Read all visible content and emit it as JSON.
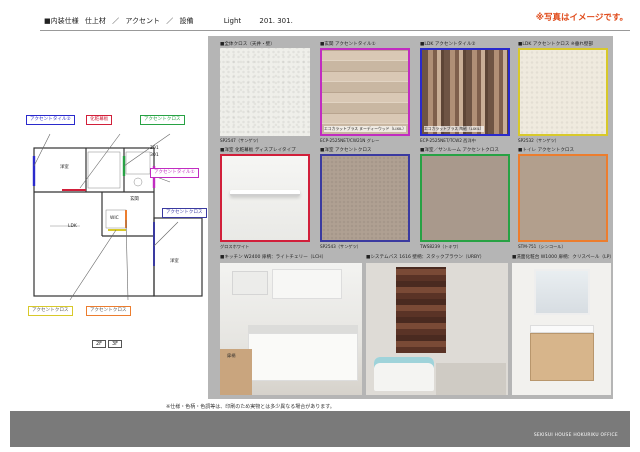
{
  "header": {
    "section": "■内装仕様",
    "breadcrumb": [
      "仕上材",
      "／",
      "アクセント",
      "／",
      "設備"
    ],
    "plan_type": "Light",
    "units": "201. 301.",
    "note": "※写真はイメージです。"
  },
  "plan": {
    "tags": [
      {
        "label": "アクセントタイル②",
        "color": "#2a2acc"
      },
      {
        "label": "化粧幕板",
        "color": "#d11f3a"
      },
      {
        "label": "アクセントクロス",
        "color": "#27a244"
      },
      {
        "label": "アクセントタイル①",
        "color": "#c12cc1"
      },
      {
        "label": "アクセントクロス",
        "color": "#3a3aa0"
      },
      {
        "label": "アクセントクロス",
        "color": "#d8c92a"
      },
      {
        "label": "アクセントクロス",
        "color": "#ec7d2e"
      }
    ],
    "room_labels": [
      "洋室",
      "LDK",
      "洋室",
      "WIC",
      "玄関"
    ],
    "unit_label_1": "201",
    "unit_label_2": "301",
    "floors": [
      "2F",
      "3F"
    ]
  },
  "finishes": [
    {
      "caption": "■全体クロス（天井・壁）",
      "code": "SP2547（サンゲツ）",
      "texture": "wall",
      "border": "transparent"
    },
    {
      "caption": "■玄関 アクセントタイル①",
      "code": "ECP-2525NET/CW21N グレー",
      "overlay": "エコカラットプラス ヌーディーウッド（LIXIL）",
      "texture": "tile1",
      "border": "#c12cc1"
    },
    {
      "caption": "■LDK アクセントタイル②",
      "code": "ECP-2525NET/TCW2 西洋中",
      "overlay": "エコカラットプラス 陶磁（LIXIL）",
      "texture": "tile2",
      "border": "#2a2acc"
    },
    {
      "caption": "■LDK アクセントクロス ※垂れ壁部",
      "code": "SP2532（サンゲツ）",
      "texture": "yellowish",
      "border": "#d8c92a"
    },
    {
      "caption": "■洋室 化粧幕板 ディスプレイタイプ",
      "code": "グロスホワイト",
      "texture": "white",
      "border": "#d11f3a"
    },
    {
      "caption": "■洋室 アクセントクロス",
      "code": "SP2543（サンゲツ）",
      "texture": "taupe",
      "border": "#3a3aa0"
    },
    {
      "caption": "■洋室／サンルーム アクセントクロス",
      "code": "TWS8239（トキワ）",
      "texture": "taupe2",
      "border": "#27a244"
    },
    {
      "caption": "■トイレ アクセントクロス",
      "code": "STM-751（シンコール）",
      "texture": "beige",
      "border": "#ec7d2e"
    }
  ],
  "equipment": [
    {
      "caption": "■キッチン W2400 扉柄：ライトチェリー（LCH）",
      "swatch_label": "扉柄"
    },
    {
      "caption": "■システムバス 1616 壁柄：スタックブラウン（URBY）"
    },
    {
      "caption": "■洗面化粧台 W1000 扉柄：クリスペール（LP）"
    }
  ],
  "footer": {
    "disclaimer": "※仕様・色柄・色調等は、印刷のため実物とは多少異なる場合があります。",
    "company": "SEKISUI HOUSE HOKURIKU OFFICE"
  }
}
